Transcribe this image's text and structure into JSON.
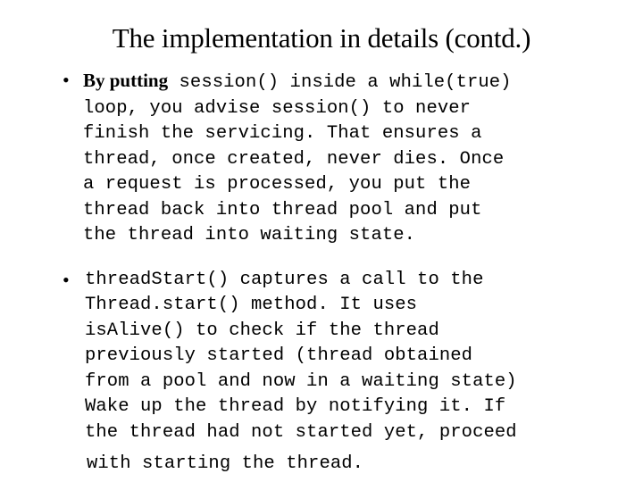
{
  "slide": {
    "title": "The implementation in details (contd.)",
    "bullet_marker": "•",
    "bullets": [
      {
        "id": "bullet-1",
        "lead_serif": "By putting",
        "lines": [
          " session() inside a while(true)",
          "loop, you advise session() to never",
          "finish the servicing. That ensures a",
          "thread, once created, never dies. Once",
          "a request is processed, you put the",
          "thread back into thread pool and put",
          "the thread into waiting state."
        ]
      },
      {
        "id": "bullet-2",
        "lead_serif": "",
        "lines": [
          "threadStart() captures a call to the",
          "Thread.start() method. It uses",
          "isAlive() to check if the thread",
          "previously started (thread obtained",
          "from a pool and now in a waiting state)",
          "Wake up the thread by notifying it. If",
          "the thread had not started yet, proceed",
          "with starting the thread."
        ]
      }
    ]
  },
  "colors": {
    "background": "#ffffff",
    "text": "#000000"
  }
}
